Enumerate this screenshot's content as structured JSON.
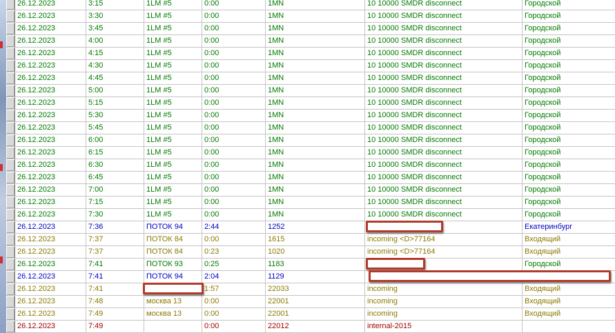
{
  "colors": {
    "green": "#007a00",
    "blue": "#0000c0",
    "olive": "#8a7a00",
    "maroon": "#a00000",
    "redaction_border": "#b23a2a"
  },
  "rows": [
    {
      "date": "26.12.2023",
      "time": "3:15",
      "line": "1LM #5",
      "duration": "0:00",
      "number": "1MN",
      "info": "10  10000 SMDR disconnect",
      "type": "Городской",
      "color": "green"
    },
    {
      "date": "26.12.2023",
      "time": "3:30",
      "line": "1LM #5",
      "duration": "0:00",
      "number": "1MN",
      "info": "10  10000 SMDR disconnect",
      "type": "Городской",
      "color": "green"
    },
    {
      "date": "26.12.2023",
      "time": "3:45",
      "line": "1LM #5",
      "duration": "0:00",
      "number": "1MN",
      "info": "10  10000 SMDR disconnect",
      "type": "Городской",
      "color": "green"
    },
    {
      "date": "26.12.2023",
      "time": "4:00",
      "line": "1LM #5",
      "duration": "0:00",
      "number": "1MN",
      "info": "10  10000 SMDR disconnect",
      "type": "Городской",
      "color": "green"
    },
    {
      "date": "26.12.2023",
      "time": "4:15",
      "line": "1LM #5",
      "duration": "0:00",
      "number": "1MN",
      "info": "10  10000 SMDR disconnect",
      "type": "Городской",
      "color": "green"
    },
    {
      "date": "26.12.2023",
      "time": "4:30",
      "line": "1LM #5",
      "duration": "0:00",
      "number": "1MN",
      "info": "10  10000 SMDR disconnect",
      "type": "Городской",
      "color": "green"
    },
    {
      "date": "26.12.2023",
      "time": "4:45",
      "line": "1LM #5",
      "duration": "0:00",
      "number": "1MN",
      "info": "10  10000 SMDR disconnect",
      "type": "Городской",
      "color": "green"
    },
    {
      "date": "26.12.2023",
      "time": "5:00",
      "line": "1LM #5",
      "duration": "0:00",
      "number": "1MN",
      "info": "10  10000 SMDR disconnect",
      "type": "Городской",
      "color": "green"
    },
    {
      "date": "26.12.2023",
      "time": "5:15",
      "line": "1LM #5",
      "duration": "0:00",
      "number": "1MN",
      "info": "10  10000 SMDR disconnect",
      "type": "Городской",
      "color": "green"
    },
    {
      "date": "26.12.2023",
      "time": "5:30",
      "line": "1LM #5",
      "duration": "0:00",
      "number": "1MN",
      "info": "10  10000 SMDR disconnect",
      "type": "Городской",
      "color": "green"
    },
    {
      "date": "26.12.2023",
      "time": "5:45",
      "line": "1LM #5",
      "duration": "0:00",
      "number": "1MN",
      "info": "10  10000 SMDR disconnect",
      "type": "Городской",
      "color": "green"
    },
    {
      "date": "26.12.2023",
      "time": "6:00",
      "line": "1LM #5",
      "duration": "0:00",
      "number": "1MN",
      "info": "10  10000 SMDR disconnect",
      "type": "Городской",
      "color": "green"
    },
    {
      "date": "26.12.2023",
      "time": "6:15",
      "line": "1LM #5",
      "duration": "0:00",
      "number": "1MN",
      "info": "10  10000 SMDR disconnect",
      "type": "Городской",
      "color": "green"
    },
    {
      "date": "26.12.2023",
      "time": "6:30",
      "line": "1LM #5",
      "duration": "0:00",
      "number": "1MN",
      "info": "10  10000 SMDR disconnect",
      "type": "Городской",
      "color": "green"
    },
    {
      "date": "26.12.2023",
      "time": "6:45",
      "line": "1LM #5",
      "duration": "0:00",
      "number": "1MN",
      "info": "10  10000 SMDR disconnect",
      "type": "Городской",
      "color": "green"
    },
    {
      "date": "26.12.2023",
      "time": "7:00",
      "line": "1LM #5",
      "duration": "0:00",
      "number": "1MN",
      "info": "10  10000 SMDR disconnect",
      "type": "Городской",
      "color": "green"
    },
    {
      "date": "26.12.2023",
      "time": "7:15",
      "line": "1LM #5",
      "duration": "0:00",
      "number": "1MN",
      "info": "10  10000 SMDR disconnect",
      "type": "Городской",
      "color": "green"
    },
    {
      "date": "26.12.2023",
      "time": "7:30",
      "line": "1LM #5",
      "duration": "0:00",
      "number": "1MN",
      "info": "10  10000 SMDR disconnect",
      "type": "Городской",
      "color": "green"
    },
    {
      "date": "26.12.2023",
      "time": "7:36",
      "line": "ПОТОК 94",
      "duration": "2:44",
      "number": "1252",
      "info": "",
      "type": "Екатеринбург",
      "color": "blue"
    },
    {
      "date": "26.12.2023",
      "time": "7:37",
      "line": "ПОТОК 84",
      "duration": "0:00",
      "number": "1615",
      "info": "incoming <D>77164",
      "type": "Входящий",
      "color": "olive"
    },
    {
      "date": "26.12.2023",
      "time": "7:37",
      "line": "ПОТОК 84",
      "duration": "0:23",
      "number": "1020",
      "info": "incoming <D>77164",
      "type": "Входящий",
      "color": "olive"
    },
    {
      "date": "26.12.2023",
      "time": "7:41",
      "line": "ПОТОК 93",
      "duration": "0:25",
      "number": "1183",
      "info": "",
      "type": "Городской",
      "color": "green"
    },
    {
      "date": "26.12.2023",
      "time": "7:41",
      "line": "ПОТОК 94",
      "duration": "2:04",
      "number": "1129",
      "info": "",
      "type": "",
      "color": "blue"
    },
    {
      "date": "26.12.2023",
      "time": "7:41",
      "line": "",
      "duration": "1:57",
      "number": "22033",
      "info": "incoming",
      "type": "Входящий",
      "color": "olive"
    },
    {
      "date": "26.12.2023",
      "time": "7:48",
      "line": "москва 13",
      "duration": "0:00",
      "number": "22001",
      "info": "incoming",
      "type": "Входящий",
      "color": "olive"
    },
    {
      "date": "26.12.2023",
      "time": "7:49",
      "line": "москва 13",
      "duration": "0:00",
      "number": "22001",
      "info": "incoming",
      "type": "Входящий",
      "color": "olive"
    },
    {
      "date": "26.12.2023",
      "time": "7:49",
      "line": "",
      "duration": "0:00",
      "number": "22012",
      "info": "internal-2015",
      "type": "",
      "color": "maroon"
    }
  ]
}
